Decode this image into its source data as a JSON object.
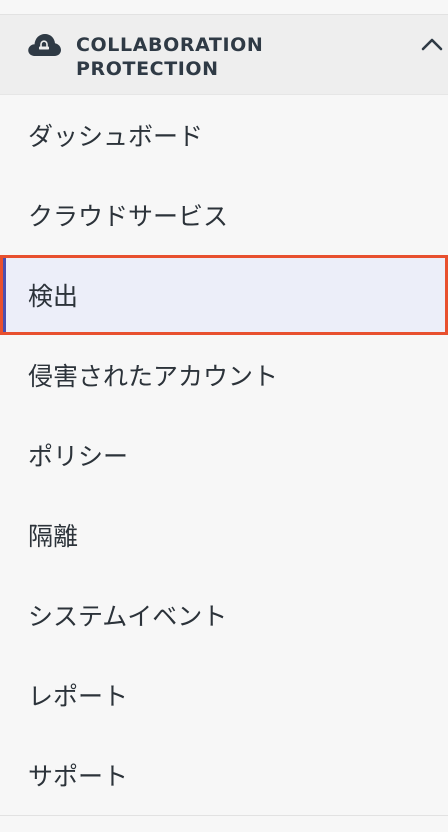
{
  "section": {
    "title_line1": "COLLABORATION",
    "title_line2": "PROTECTION",
    "icon": "cloud-lock-icon",
    "toggle_icon": "chevron-up-icon",
    "expanded": true
  },
  "menu": {
    "items": [
      {
        "label": "ダッシュボード",
        "active": false
      },
      {
        "label": "クラウドサービス",
        "active": false
      },
      {
        "label": "検出",
        "active": true
      },
      {
        "label": "侵害されたアカウント",
        "active": false
      },
      {
        "label": "ポリシー",
        "active": false
      },
      {
        "label": "隔離",
        "active": false
      },
      {
        "label": "システムイベント",
        "active": false
      },
      {
        "label": "レポート",
        "active": false
      },
      {
        "label": "サポート",
        "active": false
      }
    ]
  },
  "colors": {
    "active_background": "#eceef9",
    "active_outline": "#e8502f",
    "active_indicator": "#4b4fb0",
    "header_background": "#eeeeee",
    "text": "#2c333a"
  }
}
